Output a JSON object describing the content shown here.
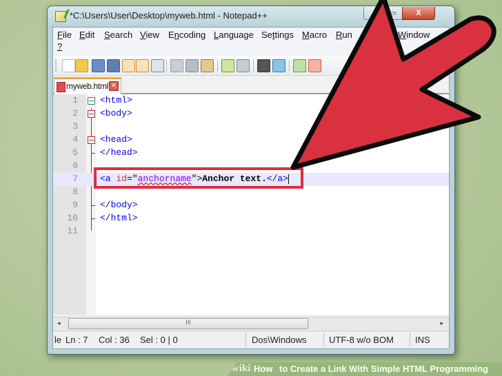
{
  "window": {
    "title": "*C:\\Users\\User\\Desktop\\myweb.html - Notepad++",
    "controls": {
      "minimize": "_",
      "maximize": "▭",
      "close": "X"
    }
  },
  "menu": {
    "items": [
      {
        "label": "File",
        "accel": "F"
      },
      {
        "label": "Edit",
        "accel": "E"
      },
      {
        "label": "Search",
        "accel": "S"
      },
      {
        "label": "View",
        "accel": "V"
      },
      {
        "label": "Encoding",
        "accel": "n"
      },
      {
        "label": "Language",
        "accel": "L"
      },
      {
        "label": "Settings",
        "accel": "t"
      },
      {
        "label": "Macro",
        "accel": "M"
      },
      {
        "label": "Run",
        "accel": "R"
      },
      {
        "label": "Window",
        "accel": "W"
      },
      {
        "label": "?",
        "accel": "?"
      }
    ]
  },
  "toolbar": {
    "buttons": [
      "new-file",
      "open-file",
      "save",
      "save-all",
      "close",
      "close-all",
      "print",
      "cut",
      "copy",
      "paste",
      "undo",
      "redo",
      "find",
      "replace",
      "zoom-in",
      "zoom-out"
    ]
  },
  "tabs": [
    {
      "label": "myweb.html",
      "close": "✕"
    }
  ],
  "editor": {
    "lines": [
      {
        "n": "1",
        "code": "<html>"
      },
      {
        "n": "2",
        "code": "<body>"
      },
      {
        "n": "3",
        "code": ""
      },
      {
        "n": "4",
        "code": "<head>"
      },
      {
        "n": "5",
        "code": "</head>"
      },
      {
        "n": "6",
        "code": ""
      },
      {
        "n": "7",
        "tag_open": "<a ",
        "attr": "id",
        "eq": "=\"",
        "str": "anchorname",
        "close_q": "\">",
        "text": "Anchor text.",
        "tag_close": "</a>"
      },
      {
        "n": "8",
        "code": ""
      },
      {
        "n": "9",
        "code": "</body>"
      },
      {
        "n": "10",
        "code": "</html>"
      },
      {
        "n": "11",
        "code": ""
      }
    ],
    "current_line": 7
  },
  "scrollbar": {
    "left": "◂",
    "right": "▸",
    "grip": "III"
  },
  "status": {
    "mode": "le",
    "ln": "Ln : 7",
    "col": "Col : 36",
    "sel": "Sel : 0 | 0",
    "eol": "Dos\\Windows",
    "encoding": "UTF-8 w/o BOM",
    "insert": "INS"
  },
  "banner": {
    "brand": "wiki",
    "how": "How",
    "title": "to Create a Link With Simple HTML Programming"
  },
  "colors": {
    "annotation_red": "#d9313f",
    "background": "#b4c89a"
  }
}
